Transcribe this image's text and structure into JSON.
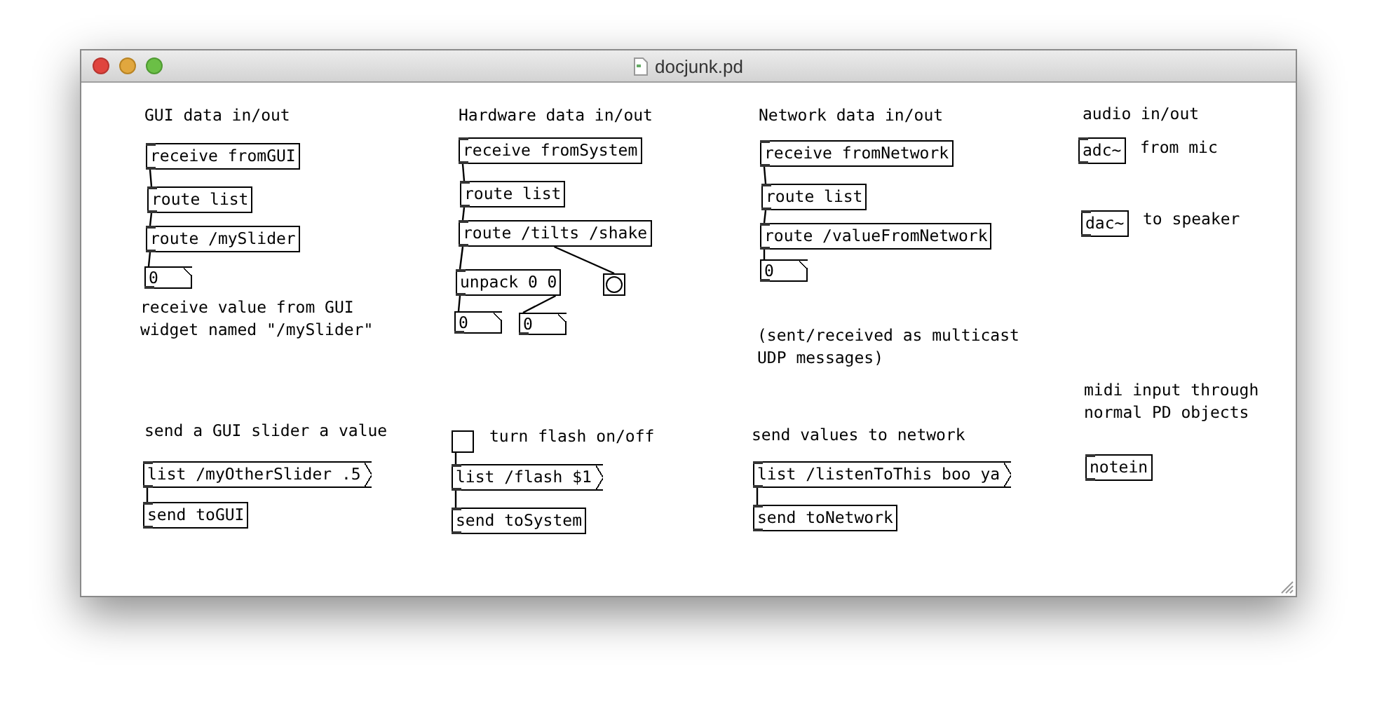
{
  "window": {
    "title": "docjunk.pd"
  },
  "patch": {
    "items": [
      {
        "kind": "comment",
        "text": "GUI data in/out"
      },
      {
        "kind": "object",
        "text": "receive fromGUI"
      },
      {
        "kind": "object",
        "text": "route list"
      },
      {
        "kind": "object",
        "text": "route /mySlider"
      },
      {
        "kind": "number",
        "value": "0"
      },
      {
        "kind": "comment",
        "text": "receive value from GUI\nwidget named \"/mySlider\""
      },
      {
        "kind": "comment",
        "text": "Hardware data in/out"
      },
      {
        "kind": "object",
        "text": "receive fromSystem"
      },
      {
        "kind": "object",
        "text": "route list"
      },
      {
        "kind": "object",
        "text": "route /tilts /shake"
      },
      {
        "kind": "object",
        "text": "unpack 0 0"
      },
      {
        "kind": "bang"
      },
      {
        "kind": "number",
        "value": "0"
      },
      {
        "kind": "number",
        "value": "0"
      },
      {
        "kind": "comment",
        "text": "Network data in/out"
      },
      {
        "kind": "object",
        "text": "receive fromNetwork"
      },
      {
        "kind": "object",
        "text": "route list"
      },
      {
        "kind": "object",
        "text": "route /valueFromNetwork"
      },
      {
        "kind": "number",
        "value": "0"
      },
      {
        "kind": "comment",
        "text": "(sent/received as multicast\nUDP messages)"
      },
      {
        "kind": "comment",
        "text": "audio in/out"
      },
      {
        "kind": "object",
        "text": "adc~"
      },
      {
        "kind": "comment",
        "text": "from mic"
      },
      {
        "kind": "object",
        "text": "dac~"
      },
      {
        "kind": "comment",
        "text": "to speaker"
      },
      {
        "kind": "comment",
        "text": "midi input through\nnormal PD objects"
      },
      {
        "kind": "object",
        "text": "notein"
      },
      {
        "kind": "comment",
        "text": "send a GUI slider a value"
      },
      {
        "kind": "message",
        "text": "list /myOtherSlider .5"
      },
      {
        "kind": "object",
        "text": "send toGUI"
      },
      {
        "kind": "toggle",
        "checked": false
      },
      {
        "kind": "comment",
        "text": "turn flash on/off"
      },
      {
        "kind": "message",
        "text": "list /flash $1"
      },
      {
        "kind": "object",
        "text": "send toSystem"
      },
      {
        "kind": "comment",
        "text": "send values to network"
      },
      {
        "kind": "message",
        "text": "list /listenToThis boo ya"
      },
      {
        "kind": "object",
        "text": "send toNetwork"
      }
    ]
  }
}
